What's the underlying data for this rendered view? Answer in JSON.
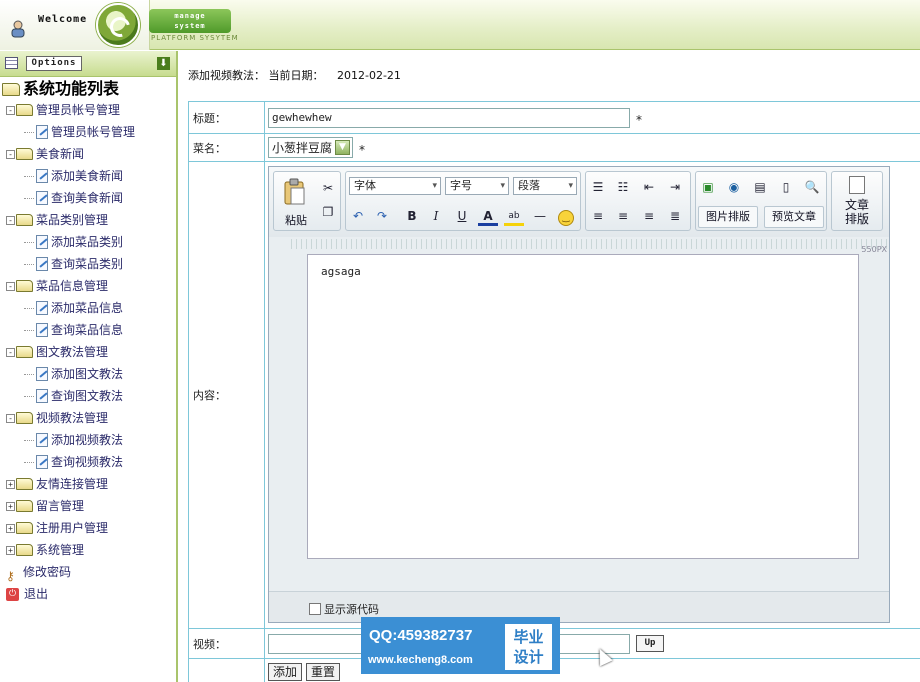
{
  "header": {
    "welcome": "Welcome",
    "badge_line1": "manage",
    "badge_line2": "system",
    "platform": "PLATFORM SYSYTEM"
  },
  "sidebar": {
    "options_label": "Options",
    "root": "系统功能列表",
    "items": [
      {
        "label": "管理员帐号管理",
        "level": 1,
        "type": "folder",
        "sign": "-"
      },
      {
        "label": "管理员帐号管理",
        "level": 2,
        "type": "doc"
      },
      {
        "label": "美食新闻",
        "level": 1,
        "type": "folder",
        "sign": "-"
      },
      {
        "label": "添加美食新闻",
        "level": 2,
        "type": "doc"
      },
      {
        "label": "查询美食新闻",
        "level": 2,
        "type": "doc"
      },
      {
        "label": "菜品类别管理",
        "level": 1,
        "type": "folder",
        "sign": "-"
      },
      {
        "label": "添加菜品类别",
        "level": 2,
        "type": "doc"
      },
      {
        "label": "查询菜品类别",
        "level": 2,
        "type": "doc"
      },
      {
        "label": "菜品信息管理",
        "level": 1,
        "type": "folder",
        "sign": "-"
      },
      {
        "label": "添加菜品信息",
        "level": 2,
        "type": "doc"
      },
      {
        "label": "查询菜品信息",
        "level": 2,
        "type": "doc"
      },
      {
        "label": "图文教法管理",
        "level": 1,
        "type": "folder",
        "sign": "-"
      },
      {
        "label": "添加图文教法",
        "level": 2,
        "type": "doc"
      },
      {
        "label": "查询图文教法",
        "level": 2,
        "type": "doc"
      },
      {
        "label": "视频教法管理",
        "level": 1,
        "type": "folder",
        "sign": "-"
      },
      {
        "label": "添加视频教法",
        "level": 2,
        "type": "doc"
      },
      {
        "label": "查询视频教法",
        "level": 2,
        "type": "doc"
      },
      {
        "label": "友情连接管理",
        "level": 1,
        "type": "folder",
        "sign": "+"
      },
      {
        "label": "留言管理",
        "level": 1,
        "type": "folder",
        "sign": "+"
      },
      {
        "label": "注册用户管理",
        "level": 1,
        "type": "folder",
        "sign": "+"
      },
      {
        "label": "系统管理",
        "level": 1,
        "type": "folder",
        "sign": "+"
      },
      {
        "label": "修改密码",
        "level": 1,
        "type": "key"
      },
      {
        "label": "退出",
        "level": 1,
        "type": "exit"
      }
    ]
  },
  "main": {
    "breadcrumb": "添加视频教法：",
    "date_label": "当前日期：",
    "date_value": "2012-02-21",
    "form": {
      "title_label": "标题：",
      "title_value": "gewhewhew",
      "required_mark": "*",
      "dish_label": "菜名：",
      "dish_value": "小葱拌豆腐",
      "content_label": "内容：",
      "video_label": "视频：",
      "video_value": "",
      "upload_label": "Up",
      "submit_label": "添加",
      "reset_label": "重置"
    },
    "editor": {
      "paste_label": "粘贴",
      "font_select": "字体",
      "size_select": "字号",
      "paragraph_select": "段落",
      "image_layout_label": "图片排版",
      "preview_label": "预览文章",
      "article_layout_label_1": "文章",
      "article_layout_label_2": "排版",
      "ruler_label": "550PX",
      "content_text": "agsaga",
      "show_source_label": "显示源代码"
    }
  },
  "watermark": {
    "qq": "QQ:459382737",
    "site": "www.kecheng8.com",
    "badge_1": "毕业",
    "badge_2": "设计"
  }
}
